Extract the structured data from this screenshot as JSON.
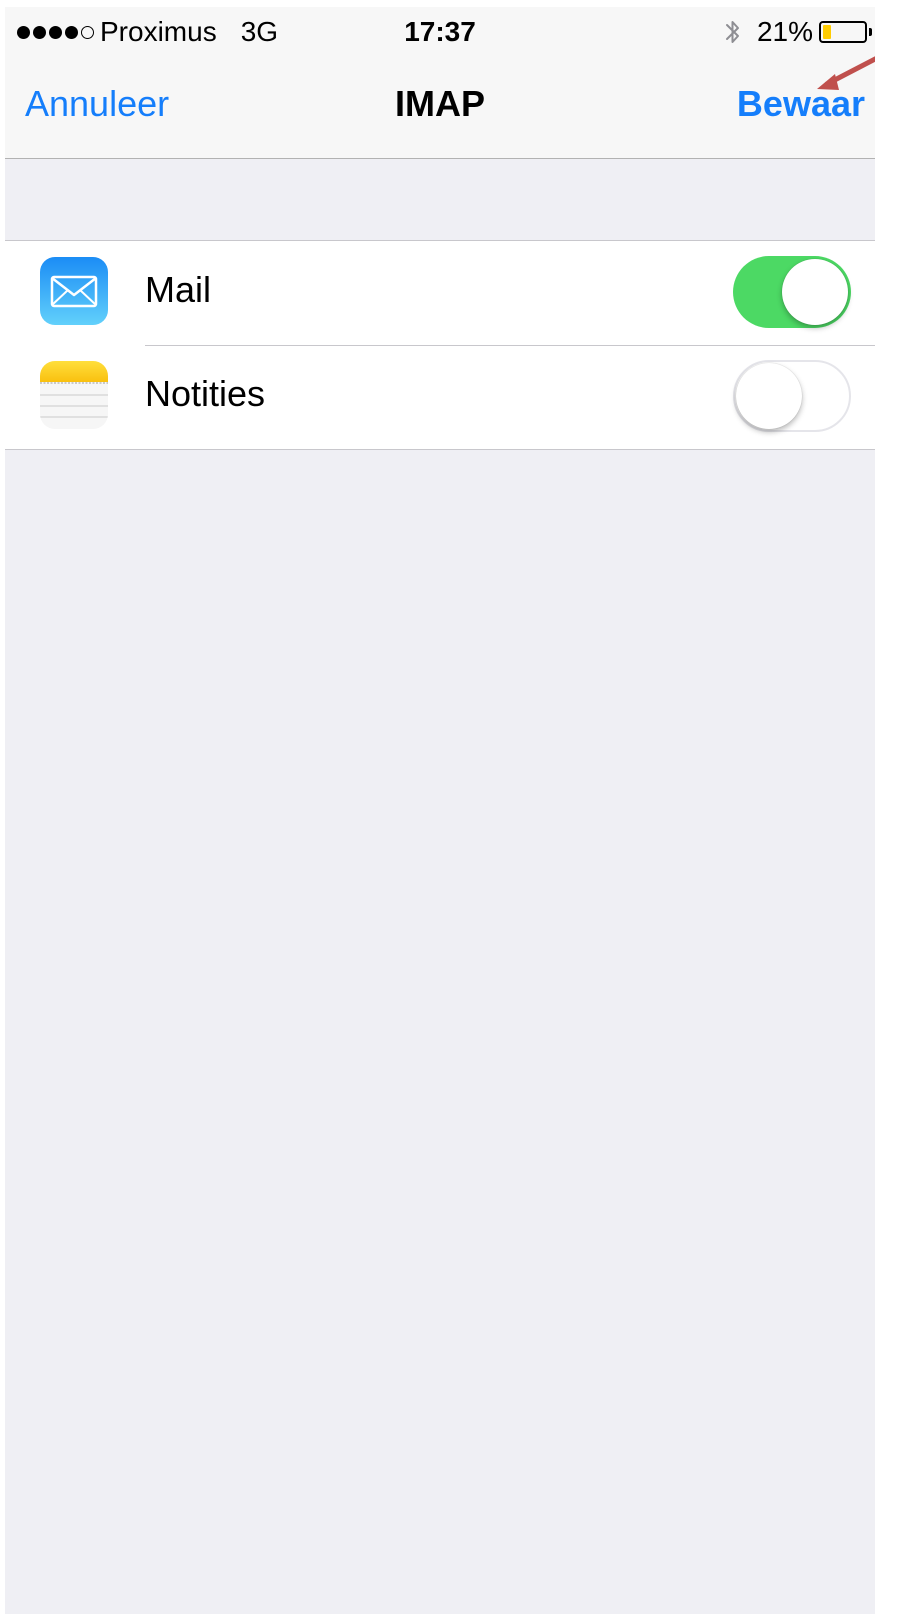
{
  "status_bar": {
    "signal_dots": [
      true,
      true,
      true,
      true,
      false
    ],
    "carrier": "Proximus",
    "network": "3G",
    "time": "17:37",
    "bluetooth_icon": "bluetooth-icon",
    "battery_percent": "21%",
    "battery_level": 0.21,
    "battery_color": "#ffcc00"
  },
  "nav": {
    "cancel_label": "Annuleer",
    "title": "IMAP",
    "save_label": "Bewaar",
    "accent_color": "#157efb",
    "annotation_arrow_color": "#c0504d"
  },
  "rows": [
    {
      "label": "Mail",
      "icon": "mail-app-icon",
      "enabled": true
    },
    {
      "label": "Notities",
      "icon": "notes-app-icon",
      "enabled": false
    }
  ],
  "toggle_on_color": "#4cd964"
}
